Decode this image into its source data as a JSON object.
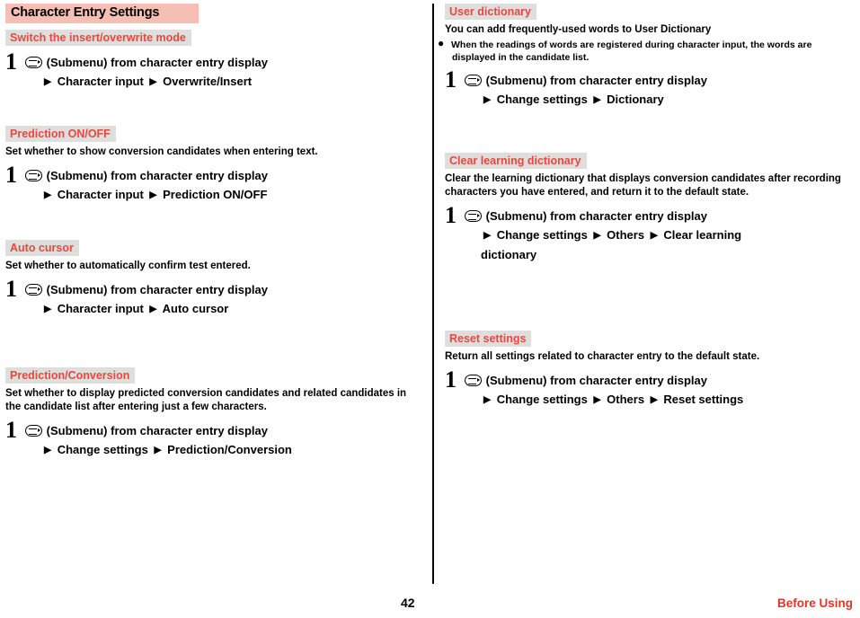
{
  "chapter": {
    "title": "Character Entry Settings"
  },
  "footer": {
    "page_number": "42",
    "chapter_label": "Before Using"
  },
  "icons": {
    "submenu_key": "submenu-key-icon",
    "arrow": "▶"
  },
  "left": {
    "sections": [
      {
        "heading": "Switch the insert/overwrite mode",
        "desc": "",
        "step_number": "1",
        "line1_pre": "(Submenu) from character entry display",
        "line2": [
          "Character input",
          "Overwrite/Insert"
        ]
      },
      {
        "heading": "Prediction ON/OFF",
        "desc": "Set whether to show conversion candidates when entering text.",
        "step_number": "1",
        "line1_pre": "(Submenu) from character entry display",
        "line2": [
          "Character input",
          "Prediction ON/OFF"
        ]
      },
      {
        "heading": "Auto cursor",
        "desc": "Set whether to automatically confirm test entered.",
        "step_number": "1",
        "line1_pre": "(Submenu) from character entry display",
        "line2": [
          "Character input",
          "Auto cursor"
        ]
      },
      {
        "heading": "Prediction/Conversion",
        "desc": "Set whether to display predicted conversion candidates and related candidates in the candidate list after entering just a few characters.",
        "step_number": "1",
        "line1_pre": "(Submenu) from character entry display",
        "line2": [
          "Change settings",
          "Prediction/Conversion"
        ]
      }
    ]
  },
  "right": {
    "sections": [
      {
        "heading": "User dictionary",
        "desc": "You can add frequently-used words to User Dictionary",
        "note": "When the readings of words are registered during character input, the words are displayed in the candidate list.",
        "step_number": "1",
        "line1_pre": "(Submenu) from character entry display",
        "line2": [
          "Change settings",
          "Dictionary"
        ]
      },
      {
        "heading": "Clear learning dictionary",
        "desc": "Clear the learning dictionary that displays conversion candidates after recording characters you have entered, and return it to the default state.",
        "step_number": "1",
        "line1_pre": "(Submenu) from character entry display",
        "line2": [
          "Change settings",
          "Others",
          "Clear learning"
        ],
        "line3": "dictionary"
      },
      {
        "heading": "Reset settings",
        "desc": "Return all settings related to character entry to the default state.",
        "step_number": "1",
        "line1_pre": "(Submenu) from character entry display",
        "line2": [
          "Change settings",
          "Others",
          "Reset settings"
        ]
      }
    ]
  }
}
